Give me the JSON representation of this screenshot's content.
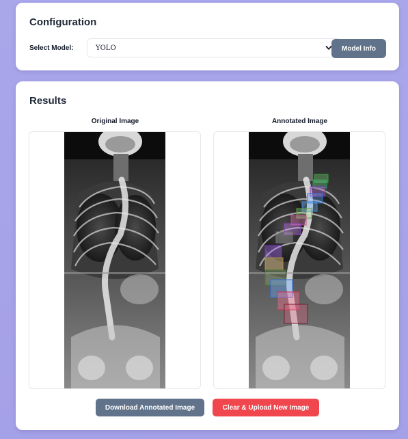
{
  "config": {
    "title": "Configuration",
    "select_label": "Select Model:",
    "select_value": "YOLO",
    "model_info_label": "Model Info"
  },
  "results": {
    "title": "Results",
    "original_label": "Original Image",
    "annotated_label": "Annotated Image",
    "download_label": "Download Annotated Image",
    "clear_label": "Clear & Upload New Image"
  },
  "colors": {
    "page_bg": "#a9a6ea",
    "secondary_button": "#60738a",
    "danger_button": "#f0464d"
  }
}
